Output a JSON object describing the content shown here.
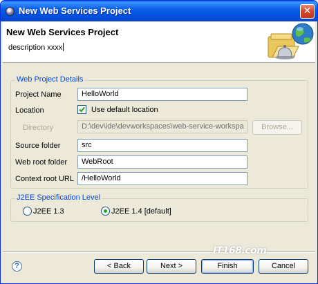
{
  "window": {
    "title": "New Web Services Project",
    "close_glyph": "✕"
  },
  "header": {
    "title": "New Web Services Project",
    "description": "description xxxx"
  },
  "web_details": {
    "group_title": "Web Project Details",
    "project_name_label": "Project Name",
    "project_name_value": "HelloWorld",
    "location_label": "Location",
    "use_default_label": "Use default location",
    "use_default_checked": true,
    "directory_label": "Directory",
    "directory_value": "D:\\dev\\ide\\devworkspaces\\web-service-workspa",
    "browse_label": "Browse...",
    "source_folder_label": "Source folder",
    "source_folder_value": "src",
    "web_root_label": "Web root folder",
    "web_root_value": "WebRoot",
    "context_root_label": "Context root URL",
    "context_root_value": "/HelloWorld"
  },
  "j2ee": {
    "group_title": "J2EE Specification Level",
    "option_13": "J2EE 1.3",
    "option_14": "J2EE 1.4 [default]",
    "selected": "J2EE 1.4 [default]"
  },
  "footer": {
    "help_glyph": "?",
    "back_label": "< Back",
    "next_label": "Next >",
    "finish_label": "Finish",
    "cancel_label": "Cancel",
    "watermark": "IT168.com"
  },
  "colors": {
    "titlebar": "#0a5fe8",
    "group_title": "#0046d5",
    "dialog_bg": "#ece9d8"
  }
}
